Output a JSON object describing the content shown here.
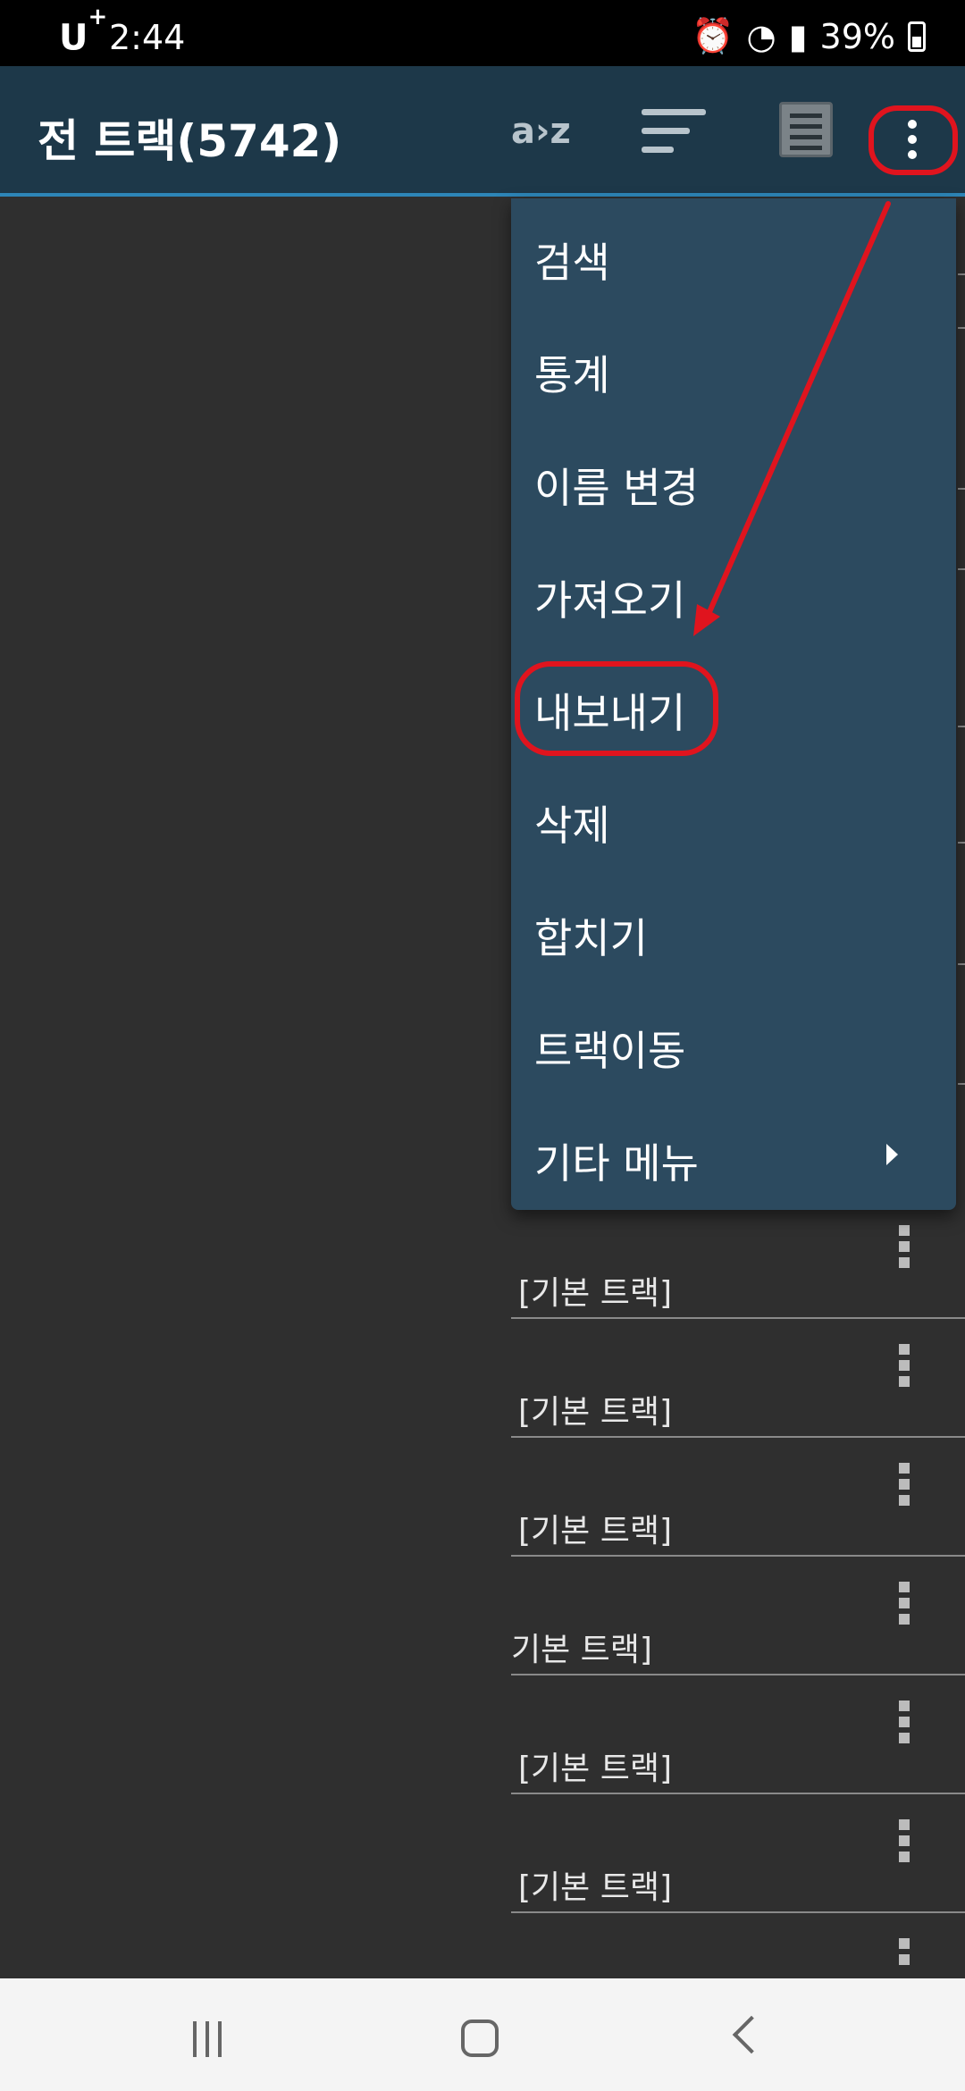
{
  "status_bar": {
    "carrier": "U",
    "carrier_sup": "+",
    "time": "2:44",
    "battery": "39%"
  },
  "app_bar": {
    "title": "전 트랙(5742)",
    "sort_az_label": "a›z",
    "icons": [
      "sort-icon",
      "list-view-icon",
      "more-vert-icon"
    ]
  },
  "menu": {
    "items": [
      {
        "label": "검색"
      },
      {
        "label": "통계"
      },
      {
        "label": "이름 변경"
      },
      {
        "label": "가져오기"
      },
      {
        "label": "내보내기"
      },
      {
        "label": "삭제"
      },
      {
        "label": "합치기"
      },
      {
        "label": "트랙이동"
      },
      {
        "label": "기타 메뉴"
      }
    ],
    "highlighted_item": "내보내기"
  },
  "track_list": {
    "rows": [
      {
        "label": "[기본 트랙]"
      },
      {
        "label": "[기본 트랙]"
      },
      {
        "label": "[기본 트랙]"
      },
      {
        "label": "기본 트랙]"
      },
      {
        "label": "[기본 트랙]"
      },
      {
        "label": "[기본 트랙]"
      }
    ]
  },
  "colors": {
    "app_bar": "#1d3849",
    "menu_bg": "#2c4a5f",
    "annotation": "#e0141e",
    "background": "#2f2f2f"
  }
}
